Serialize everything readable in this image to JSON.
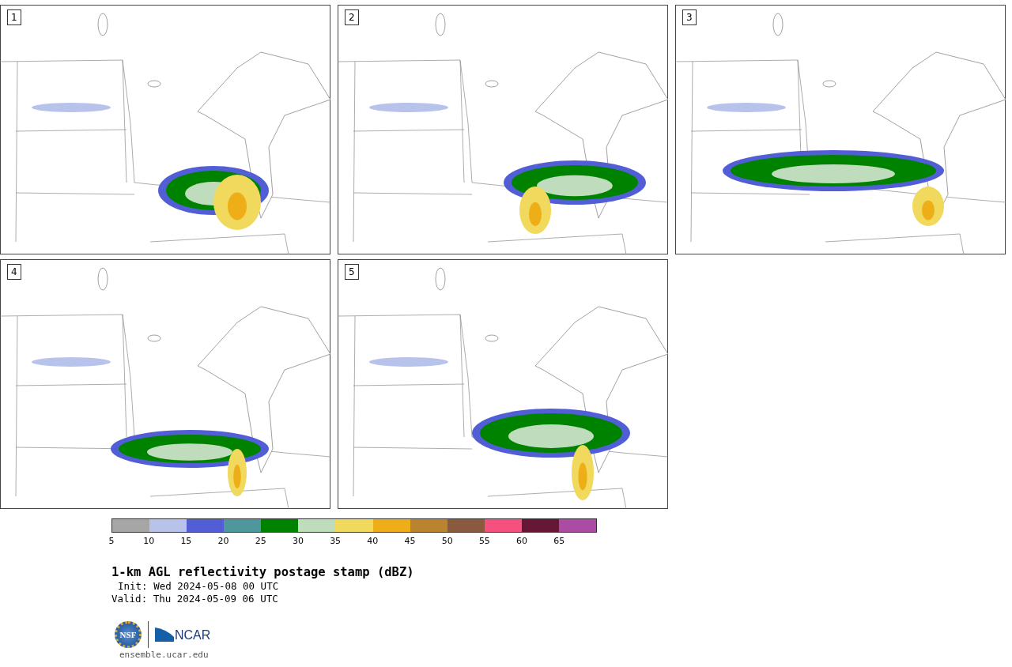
{
  "panels": [
    {
      "number": "1"
    },
    {
      "number": "2"
    },
    {
      "number": "3"
    },
    {
      "number": "4"
    },
    {
      "number": "5"
    }
  ],
  "colorbar": {
    "bins": [
      {
        "color": "#a6a6a6"
      },
      {
        "color": "#b8c3ec"
      },
      {
        "color": "#525ed6"
      },
      {
        "color": "#4f979c"
      },
      {
        "color": "#008201"
      },
      {
        "color": "#bfdcbd"
      },
      {
        "color": "#f0d95c"
      },
      {
        "color": "#eeae18"
      },
      {
        "color": "#b98330"
      },
      {
        "color": "#8a5a3e"
      },
      {
        "color": "#f5507e"
      },
      {
        "color": "#651735"
      },
      {
        "color": "#ab4ba3"
      }
    ],
    "ticks": [
      "5",
      "10",
      "15",
      "20",
      "25",
      "30",
      "35",
      "40",
      "45",
      "50",
      "55",
      "60",
      "65"
    ]
  },
  "title": "1-km AGL reflectivity postage stamp (dBZ)",
  "init": "Init: Wed 2024-05-08 00 UTC",
  "valid": "Valid: Thu 2024-05-09 06 UTC",
  "logos": {
    "nsf": "NSF",
    "ncar": "NCAR"
  },
  "url": "ensemble.ucar.edu"
}
